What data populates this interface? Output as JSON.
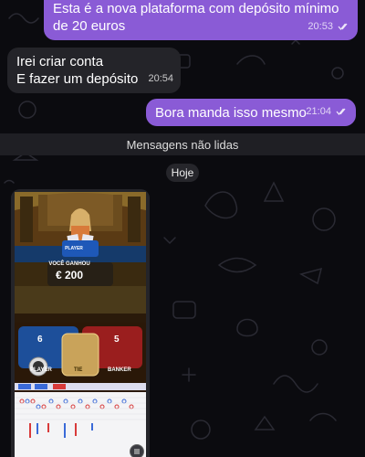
{
  "messages": [
    {
      "direction": "outgoing",
      "text": "Esta é a nova plataforma com depósito mínimo de 20 euros",
      "time": "20:53",
      "read": true
    },
    {
      "direction": "incoming",
      "lines": [
        "Irei criar conta",
        "E fazer um depósito"
      ],
      "time": "20:54"
    },
    {
      "direction": "outgoing",
      "text": "Bora manda isso mesmo",
      "time": "21:04",
      "read": true
    }
  ],
  "unread_divider": "Mensagens não lidas",
  "date_label": "Hoje",
  "media": {
    "type": "game-screenshot",
    "player_label": "PLAYER",
    "won_label": "VOCÊ GANHOU",
    "won_amount": "€ 200",
    "player_score": "6",
    "banker_score": "5",
    "player_bet": "PLAYER",
    "tie_bet": "TIE",
    "banker_bet": "BANKER"
  },
  "colors": {
    "outgoing_bubble": "#8a5bd6",
    "incoming_bubble": "#242429",
    "background": "#0b0b0f"
  }
}
